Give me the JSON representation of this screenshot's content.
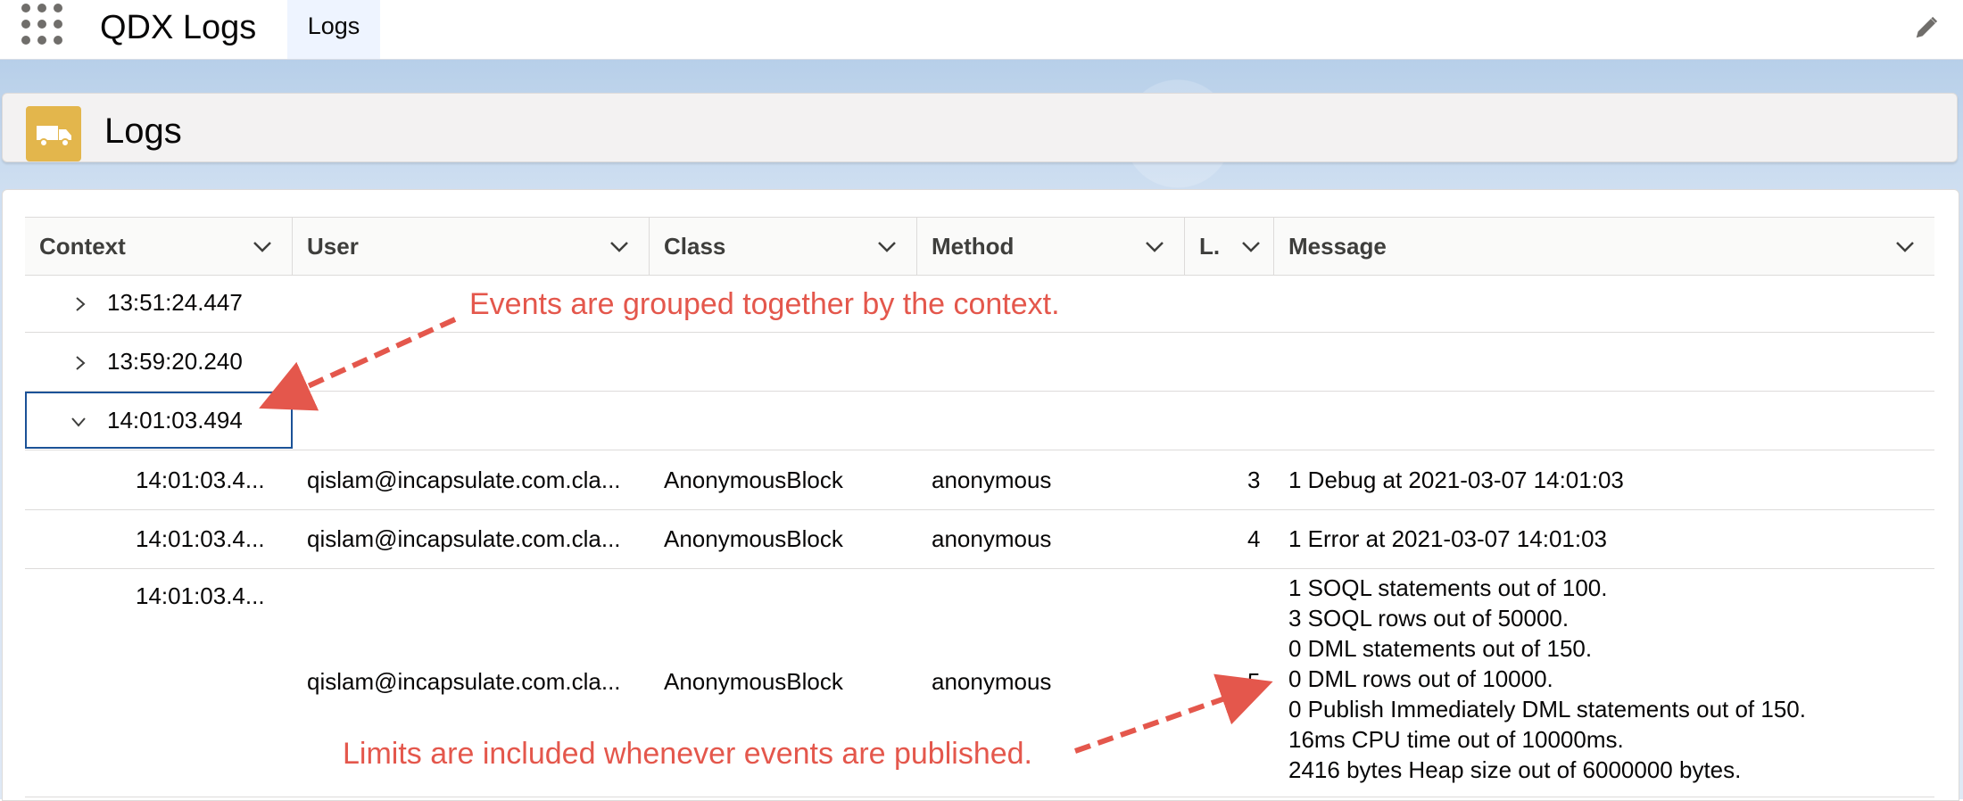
{
  "nav": {
    "app_name": "QDX Logs",
    "tab": "Logs"
  },
  "header": {
    "title": "Logs"
  },
  "columns": [
    "Context",
    "User",
    "Class",
    "Method",
    "L.",
    "Message"
  ],
  "groups": [
    "13:51:24.447",
    "13:59:20.240",
    "14:01:03.494"
  ],
  "rows": [
    {
      "context": "14:01:03.4...",
      "user": "qislam@incapsulate.com.cla...",
      "class": "AnonymousBlock",
      "method": "anonymous",
      "line": "3",
      "message": "1 Debug at 2021-03-07 14:01:03"
    },
    {
      "context": "14:01:03.4...",
      "user": "qislam@incapsulate.com.cla...",
      "class": "AnonymousBlock",
      "method": "anonymous",
      "line": "4",
      "message": "1 Error at 2021-03-07 14:01:03"
    },
    {
      "context": "14:01:03.4...",
      "user": "qislam@incapsulate.com.cla...",
      "class": "AnonymousBlock",
      "method": "anonymous",
      "line": "5",
      "message_lines": [
        "1 SOQL statements out of 100.",
        "3 SOQL rows out of 50000.",
        "0 DML statements out of 150.",
        "0 DML rows out of 10000.",
        "0 Publish Immediately DML statements out of 150.",
        "16ms CPU time out of 10000ms.",
        "2416 bytes Heap size out of 6000000 bytes."
      ]
    }
  ],
  "annotations": {
    "groups_note": "Events are grouped together by the context.",
    "limits_note": "Limits are included whenever events are published."
  },
  "colors": {
    "annotation": "#e4574c",
    "icon_bg": "#e3b64c",
    "focus": "#1b5297"
  }
}
